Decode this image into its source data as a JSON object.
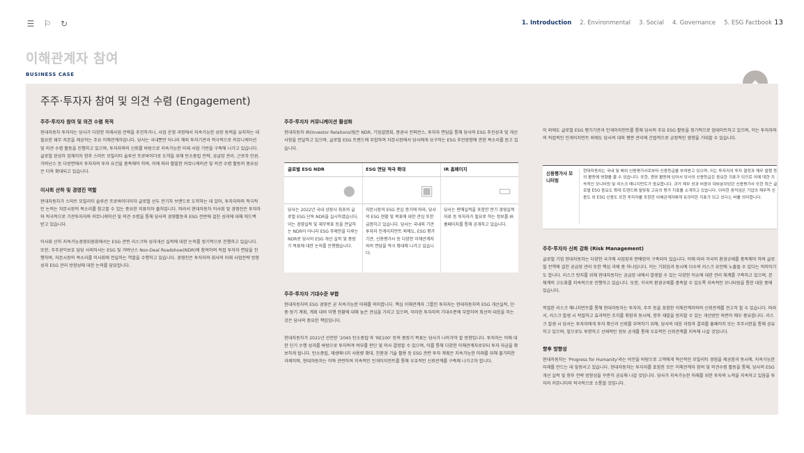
{
  "nav": {
    "items": [
      "1. Introduction",
      "2. Environmental",
      "3. Social",
      "4. Governance",
      "5. ESG Factbook"
    ],
    "page": "13"
  },
  "header": {
    "section_title": "이해관계자 참여",
    "label": "BUSINESS CASE"
  },
  "panel": {
    "title": "주주·투자자 참여 및 의견 수렴 (Engagement)"
  },
  "col1": {
    "h1": "주주·투자자 참여 및 의견 수렴 목적",
    "p1": "현대자동차 투자자는 당사가 다양한 미래사업 전략을 추진하거나, 사업 운영 과정에서 지속가능한 성장 동력을 유지하는 데 필요한 재무 자본을 제공하는 주요 이해관계자입니다. 당사는 국내뿐만 아니라 해외 투자기관과 적극적으로 커뮤니케이션 및 의견 수렴 활동을 진행하고 있으며, 투자자와의 신뢰를 바탕으로 지속가능한 미래 사업 기반을 구축해 나가고 있습니다. 글로벌 완성차 업체이자 향후 스마트 모빌리티 솔루션 프로바이더로 도약을 위해 탄소중립 전략, 공급망 관리, 근로자 인권, 거버넌스 등 다방면에서 투자자의 투자 요건을 충족해야 하며, 이에 따라 활발한 커뮤니케이션 및 의견 수렴 활동의 중요성은 더욱 확대되고 있습니다.",
    "h2": "이사회 산하 및 경영진 역할",
    "p2": "현대자동차가 스마트 모빌리티 솔루션 프로바이더이자 글로벌 선두 전기차 브랜드로 도약하는 데 있어, 투자자와의 적극적인 논의는 자본시장의 목소리를 참고할 수 있는 중요한 지표이자 출처입니다. 따라서 현대자동차 이사회 및 경영진은 투자자와 적극적으로 기관투자자와 커뮤니케이션 및 의견 수렴을 통해 당사의 경영활동과 ESG 전반에 걸친 성과에 대해 피드백 받고 있습니다.",
    "p3": "이사회 산하 지속가능경영위원회에서는 ESG 관련 리스크와 성과개선 실적에 대한 논의를 정기적으로 진행하고 있습니다. 또한, 주주권익보호 담당 사외이사는 ESG 및 거버넌스 Non-Deal Roadshow(NDR)에 참여하여 직접 투자자 면담을 진행하며, 자본시장의 목소리를 이사회에 전달하는 역할을 수행하고 있습니다. 경영진은 투자자와 회사의 미래 사업전략 방향성과 ESG 관리 방향성에 대한 논의를 담당합니다."
  },
  "col2": {
    "h1": "주주·투자자 커뮤니케이션 활성화",
    "p1": "현대자동차 IR(Investor Relations)팀은 NDR, 기업설명회, 증권사 컨퍼런스, 투자자 면담을 통해 당사의 ESG 추진성과 및 개선사항을 전달하고 있으며, 글로벌 ESG 트렌드에 부합하여 자본시장에서 당사에게 요구하는 ESG 추진방향에 관한 목소리를 듣고 있습니다.",
    "h2": "주주·투자자 기대수준 부합",
    "p2": "현대자동차의 ESG 경영은 곧 지속가능한 미래를 의미합니다. 핵심 이해관계자 그룹인 투자자는 현대자동차의 ESG 개선실적, 단·중·장기 계획, 계획 대비 이행 현황에 대해 높은 관심을 가지고 있으며, 이러한 투자자의 기대수준에 부합하여 최선의 대응을 하는 것은 당사의 중요한 책임입니다.",
    "p3": "현대자동차가 2021년 선언한 '2045 탄소중립'과 'RE100' 등의 중장기 목표는 당사가 나아가야 할 방향입니다. 투자자는 이에 대한 단기 수행 성과를 바탕으로 투자적격 여부를 판단 및 의사 결정할 수 있으며, 이를 통해 다양한 이해관계자로부터 투자 자금을 확보하게 됩니다. 탄소중립, 재생에너지 사용량 확대, 친환경 기술 활용 등 ESG 관련 투자 계획은 지속가능한 미래를 위해 불가피한 과제이며, 현대자동차는 이와 관련하여 지속적인 인게이지먼트를 통해 우호적인 신뢰관계를 구축해 나가고자 합니다."
  },
  "table": {
    "columns": [
      {
        "head": "글로벌 ESG NDR",
        "icon": "globe-dollar-icon",
        "text": "당사는 2022년 국내 상장사 최초의 글로벌 ESG 단독 NDR을 실시하였습니다. 이는 경영실적 및 재무목표 등을 전달하는 NDR이 아니라 ESG 주제만을 다루는 NDR로 당사의 ESG 개선 실적 및 중장기 목표에 대한 논의를 진행했습니다."
      },
      {
        "head": "ESG 면담 적극 확대",
        "icon": "meeting-icon",
        "text": "자본시장의 ESG 관심 증가에 따라, 당사의 ESG 현황 및 목표에 대한 관심 또한 급증하고 있습니다. 당사는 국내외 기관 투자자 인게이지먼트 외에도, ESG 평가기관, 신용평가사 등 다양한 이해관계자와의 면담을 적극 확대해 나가고 있습니다."
      },
      {
        "head": "IR 홈페이지",
        "icon": "monitor-icon",
        "text": "당사는 판매실적을 포함한 분기 경영실적 자료 등 투자자가 필요로 하는 정보를 IR 홈페이지를 통해 공개하고 있습니다."
      }
    ]
  },
  "col3": {
    "p0": "이 외에도 글로벌 ESG 평가기관과 인게이지먼트를 통해 당사의 주요 ESG 활동을 정기적으로 업데이트하고 있으며, 이는 투자자와의 직접적인 인게이지먼트 외에도 당사의 대외 평판 관리에 간접적으로 긍정적인 영향을 기대할 수 있습니다.",
    "monitor_label": "신용평가사 모니터링",
    "monitor_text": "현대자동차는 국내 및 해외 신용평가사로부터 신용등급을 부여받고 있으며, 이는 투자자의 투자 결정과 재무 발행 등의 활동에 영향을 줄 수 있습니다. 또한, 경영 활동에 있어서 당사의 신용등급은 중요한 지표가 되므로 이에 대한 지속적인 모니터링 및 리스크 매니지먼트가 중요합니다. 과거 재무 성과 비중이 대부분이었던 신용평가사 또한 최근 글로벌 ESG 중요도 확대 트렌드에 발맞춰 고유의 평가 지표를 소개하고 있습니다. 이러한 움직임은 기업의 재무적 신용도 외 ESG 신용도 또한 투자자를 포함한 이해관계자에게 유의미한 지표가 되고 있다는 바를 의미합니다.",
    "h1": "주주·투자자 신뢰 강화 (Risk Management)",
    "p1": "글로벌 기업 현대자동차는 다양한 국가에 사업장과 판매망이 구축되어 있습니다. 이에 따라 각국의 환경규제를 충족해야 하며 글로벌 전역에 걸친 공급망 관리 또한 핵심 과제 중 하나입니다. 이는 기회임과 동시에 다수의 리스크 요인에 노출될 수 있다는 의미이기도 합니다. 리스크 방지를 위해 현대자동차는 공급망 내에서 발생할 수 있는 다양한 이슈에 대한 관리 체계를 구축하고 있으며, 본 체계의 고도화를 지속적으로 진행하고 있습니다. 또한, 각국의 환경규제를 충족할 수 있도록 지속적인 모니터링을 통한 대응 중에 있습니다.",
    "p2": "적절한 리스크 매니지먼트를 통해 현대자동차는 투자자, 주주 등을 포함한 이해관계자와의 신뢰관계를 견고히 할 수 있습니다. 따라서, 리스크 발생 시 적절하고 효과적인 조치를 취함과 동시에, 향후 재발을 방지할 수 있는 개선방안 마련이 매우 중요합니다. 리스크 발생 시 당사는 투자자에게 투자 확신과 신뢰를 부여하기 위해, 당사의 대응 과정과 결과를 홈페이지 또는 주주서한을 통해 공유하고 있으며, 앞으로도 투명하고 선제적인 정보 공개를 통해 우호적인 신뢰관계를 지속해 나갈 것입니다.",
    "h2": "향후 방향성",
    "p3": "현대자동차는 'Progress for Humanity'라는 비전을 바탕으로 고객에게 혁신적인 모빌리티 경험을 제공함과 동시에, 지속가능한 미래를 만드는 데 앞장서고 있습니다. 현대자동차는 투자자를 포함한 모든 이해관계자 참여 및 의견수렴 활동을 통해, 당사의 ESG 개선 실적 및 향후 전략 방향성을 꾸준히 공유해 나갈 것입니다. 당사가 지속가능한 미래를 위한 투자와 노력을 지속하고 있음을 투자자 커뮤니티와 적극적으로 소통할 것입니다."
  }
}
